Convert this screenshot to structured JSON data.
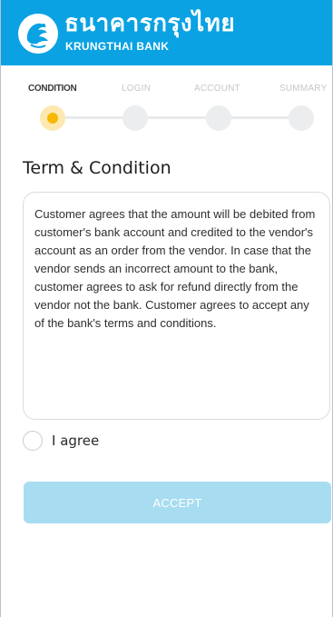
{
  "header": {
    "brand_thai": "ธนาคารกรุงไทย",
    "brand_english": "KRUNGTHAI BANK",
    "logo_icon": "krungthai-bird-logo",
    "background": "#0aa2e2"
  },
  "steps": {
    "active_index": 0,
    "items": [
      {
        "label": "CONDITION"
      },
      {
        "label": "LOGIN"
      },
      {
        "label": "ACCOUNT"
      },
      {
        "label": "SUMMARY"
      }
    ]
  },
  "terms": {
    "title": "Term & Condition",
    "body": "Customer agrees that the amount will be debited from customer's bank account and credited to the vendor's account as an order from the vendor. In case that the vendor sends an incorrect amount to the bank, customer agrees to ask for refund directly from the vendor not the bank. Customer agrees to accept any of the bank's terms and conditions."
  },
  "agreement": {
    "label": "I agree",
    "checked": false
  },
  "actions": {
    "accept_label": "ACCEPT",
    "accept_enabled": false,
    "accent": "#a8dcf0"
  }
}
